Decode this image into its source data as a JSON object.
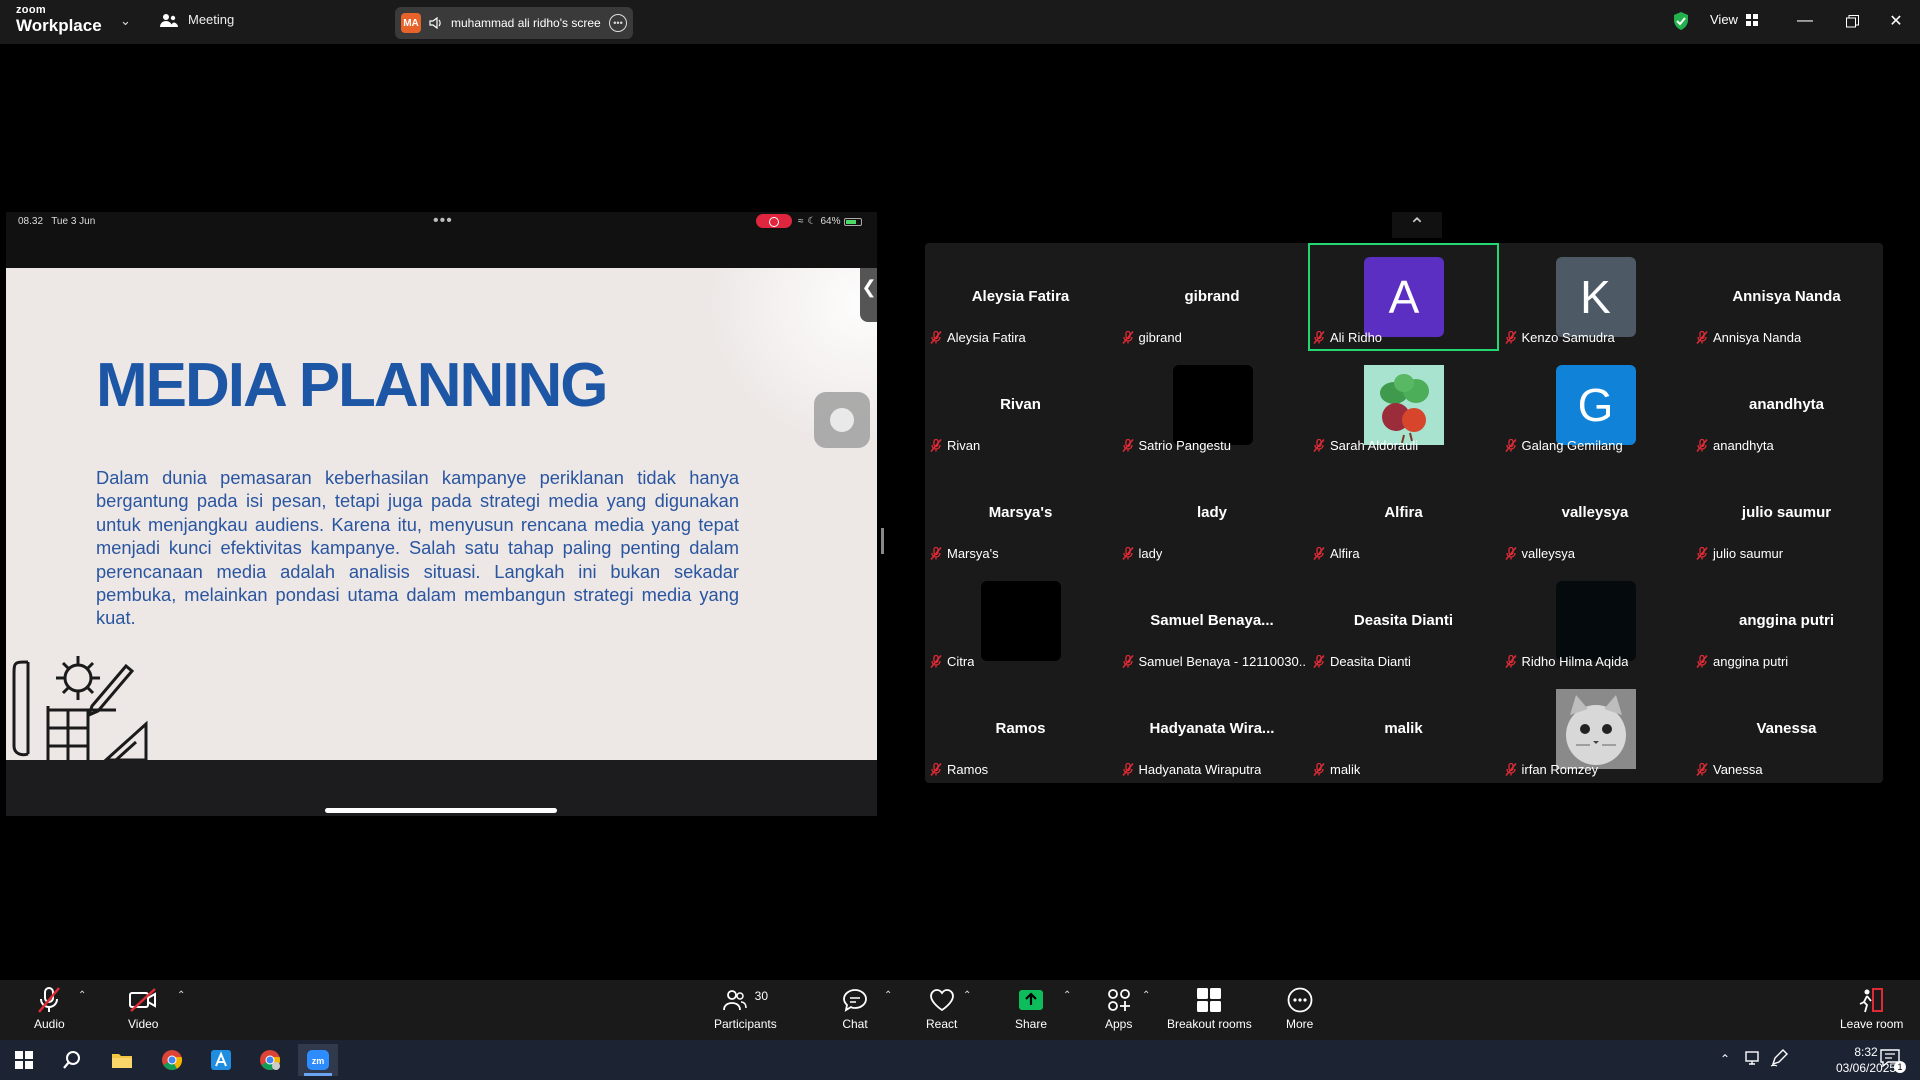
{
  "titlebar": {
    "logo_top": "zoom",
    "logo_bottom": "Workplace",
    "meeting_label": "Meeting",
    "share_initials": "MA",
    "share_text": "muhammad ali ridho's screen",
    "view_label": "View"
  },
  "ipad": {
    "time": "08.32",
    "date": "Tue 3 Jun",
    "battery": "64%"
  },
  "slide": {
    "title": "MEDIA PLANNING",
    "body": "Dalam dunia pemasaran keberhasilan kampanye periklanan tidak hanya bergantung pada isi pesan, tetapi juga pada strategi media yang digunakan untuk menjangkau audiens. Karena itu, menyusun rencana media yang tepat menjadi kunci efektivitas kampanye. Salah satu tahap paling penting dalam perencanaan media adalah analisis situasi. Langkah ini bukan sekadar pembuka, melainkan pondasi utama dalam membangun strategi media yang kuat."
  },
  "participants": [
    {
      "display": "Aleysia Fatira",
      "label": "Aleysia Fatira",
      "type": "name"
    },
    {
      "display": "gibrand",
      "label": "gibrand",
      "type": "name"
    },
    {
      "display": "A",
      "label": "Ali Ridho",
      "type": "avatar",
      "color": "#5b2fc2",
      "active": true
    },
    {
      "display": "K",
      "label": "Kenzo Samudra",
      "type": "avatar",
      "color": "#4d5a66"
    },
    {
      "display": "Annisya Nanda",
      "label": "Annisya Nanda",
      "type": "name"
    },
    {
      "display": "Rivan",
      "label": "Rivan",
      "type": "name"
    },
    {
      "display": "",
      "label": "Satrio Pangestu",
      "type": "avatar",
      "color": "#000000"
    },
    {
      "display": "",
      "label": "Sarah Aldorauli",
      "type": "photo-plant"
    },
    {
      "display": "G",
      "label": "Galang Gemilang",
      "type": "avatar",
      "color": "#1083d8"
    },
    {
      "display": "anandhyta",
      "label": "anandhyta",
      "type": "name"
    },
    {
      "display": "Marsya's",
      "label": "Marsya's",
      "type": "name"
    },
    {
      "display": "lady",
      "label": "lady",
      "type": "name"
    },
    {
      "display": "Alfira",
      "label": "Alfira",
      "type": "name"
    },
    {
      "display": "valleysya",
      "label": "valleysya",
      "type": "name"
    },
    {
      "display": "julio saumur",
      "label": "julio saumur",
      "type": "name"
    },
    {
      "display": "",
      "label": "Citra",
      "type": "avatar",
      "color": "#000000"
    },
    {
      "display": "Samuel  Benaya...",
      "label": "Samuel Benaya - 12110030...",
      "type": "name"
    },
    {
      "display": "Deasita Dianti",
      "label": "Deasita Dianti",
      "type": "name"
    },
    {
      "display": "",
      "label": "Ridho Hilma Aqida",
      "type": "avatar",
      "color": "#050a0c"
    },
    {
      "display": "anggina putri",
      "label": "anggina putri",
      "type": "name"
    },
    {
      "display": "Ramos",
      "label": "Ramos",
      "type": "name"
    },
    {
      "display": "Hadyanata  Wira...",
      "label": "Hadyanata Wiraputra",
      "type": "name"
    },
    {
      "display": "malik",
      "label": "malik",
      "type": "name"
    },
    {
      "display": "",
      "label": "irfan Romzey",
      "type": "photo-cat"
    },
    {
      "display": "Vanessa",
      "label": "Vanessa",
      "type": "name"
    }
  ],
  "toolbar": {
    "audio": "Audio",
    "video": "Video",
    "participants": "Participants",
    "participant_count": "30",
    "chat": "Chat",
    "react": "React",
    "share": "Share",
    "apps": "Apps",
    "breakout": "Breakout rooms",
    "more": "More",
    "leave": "Leave room"
  },
  "taskbar": {
    "time": "8:32",
    "date": "03/06/2025",
    "notifications": "1"
  },
  "colors": {
    "accent_green": "#23d96f",
    "slide_blue": "#1e56a6",
    "share_green": "#0dbd5c",
    "leave_red": "#e02b36"
  }
}
